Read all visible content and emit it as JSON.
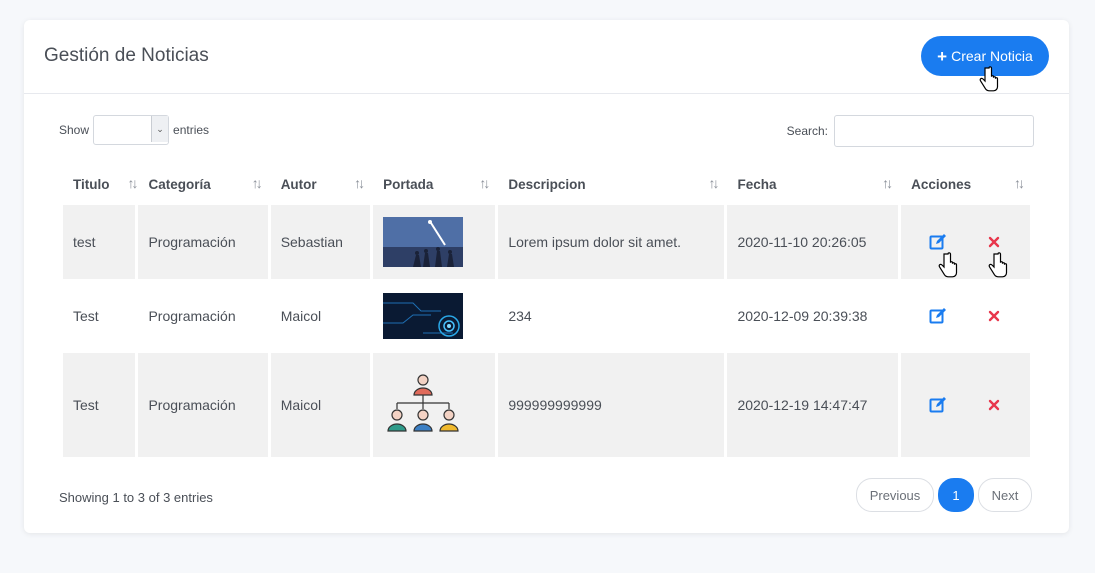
{
  "header": {
    "title": "Gestión de Noticias",
    "create_label": "Crear Noticia"
  },
  "controls": {
    "show_label": "Show",
    "entries_label": "entries",
    "search_label": "Search:",
    "search_value": ""
  },
  "table": {
    "columns": [
      "Titulo",
      "Categoría",
      "Autor",
      "Portada",
      "Descripcion",
      "Fecha",
      "Acciones"
    ],
    "rows": [
      {
        "titulo": "test",
        "categoria": "Programación",
        "autor": "Sebastian",
        "portada": "space-image",
        "descripcion": "Lorem ipsum dolor sit amet.",
        "fecha": "2020-11-10 20:26:05"
      },
      {
        "titulo": "Test",
        "categoria": "Programación",
        "autor": "Maicol",
        "portada": "tech-circuit-image",
        "descripcion": "234",
        "fecha": "2020-12-09 20:39:38"
      },
      {
        "titulo": "Test",
        "categoria": "Programación",
        "autor": "Maicol",
        "portada": "org-chart-image",
        "descripcion": "999999999999",
        "fecha": "2020-12-19 14:47:47"
      }
    ]
  },
  "footer": {
    "info": "Showing 1 to 3 of 3 entries",
    "previous": "Previous",
    "page": "1",
    "next": "Next"
  },
  "colors": {
    "primary": "#1a7cf0",
    "edit": "#1a7cf0",
    "delete": "#e8364b"
  }
}
